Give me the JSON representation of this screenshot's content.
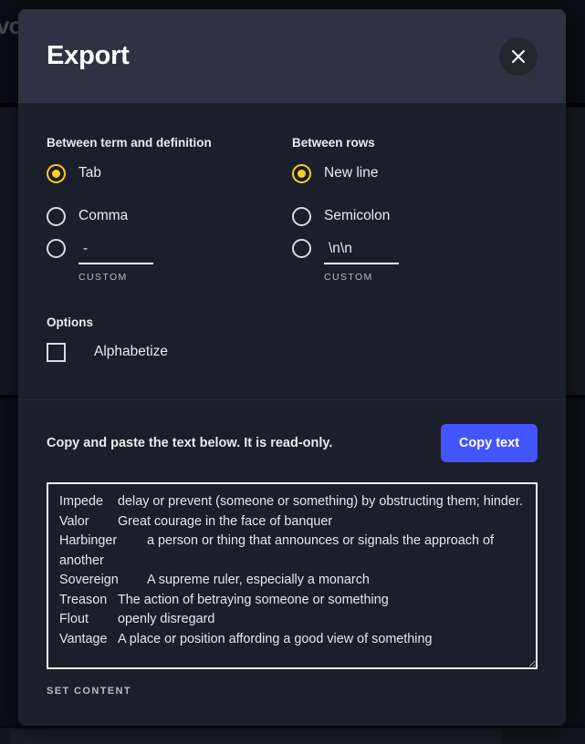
{
  "background": {
    "logo_text": "vo"
  },
  "modal": {
    "title": "Export",
    "close_icon": "close-icon",
    "term_definition": {
      "label": "Between term and definition",
      "options": [
        {
          "label": "Tab",
          "selected": true
        },
        {
          "label": "Comma",
          "selected": false
        },
        {
          "label": "",
          "selected": false
        }
      ],
      "custom_value": "-",
      "custom_caption": "CUSTOM"
    },
    "rows": {
      "label": "Between rows",
      "options": [
        {
          "label": "New line",
          "selected": true
        },
        {
          "label": "Semicolon",
          "selected": false
        },
        {
          "label": "",
          "selected": false
        }
      ],
      "custom_value": "\\n\\n",
      "custom_caption": "CUSTOM"
    },
    "options": {
      "label": "Options",
      "alphabetize_label": "Alphabetize",
      "alphabetize_checked": false
    },
    "copy": {
      "hint": "Copy and paste the text below. It is read-only.",
      "button_label": "Copy text"
    },
    "export_text": "Impede\tdelay or prevent (someone or something) by obstructing them; hinder.\nValor\tGreat courage in the face of banquer\nHarbinger\ta person or thing that announces or signals the approach of another\nSovereign\tA supreme ruler, especially a monarch\nTreason\tThe action of betraying someone or something\nFlout\topenly disregard\nVantage\tA place or position affording a good view of something",
    "set_content_label": "SET CONTENT"
  },
  "colors": {
    "modal_bg": "#1b1e2b",
    "header_bg": "#2e3242",
    "accent_yellow": "#ffcd1f",
    "accent_blue": "#4255ff",
    "text_primary": "#e9eaf0"
  }
}
